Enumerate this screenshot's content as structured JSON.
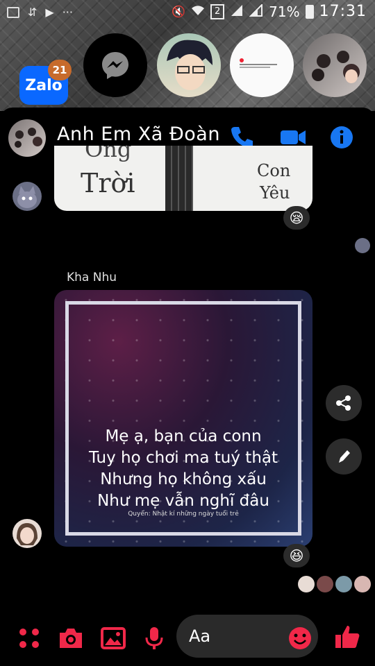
{
  "status_bar": {
    "sim_slot": "2",
    "battery": "71%",
    "time": "17:31"
  },
  "chat_heads": {
    "zalo_label": "Zalo",
    "zalo_badge": "21"
  },
  "header": {
    "title": "Anh Em Xã Đoàn"
  },
  "messages": {
    "top_image": {
      "left_text": "Trời",
      "right_text_1": "Con",
      "right_text_2": "Yêu",
      "top_left_fragment": "Ông"
    },
    "sender_name": "Kha Nhu",
    "image_text": [
      "Mẹ ạ, bạn của conn",
      "Tuy họ chơi ma tuý thật",
      "Nhưng họ không xấu",
      "Như mẹ vẫn nghĩ đâu"
    ],
    "image_credit": "Quyển: Nhật kí những ngày tuổi trẻ",
    "reaction_1": "😪",
    "reaction_2": "😆"
  },
  "composer": {
    "placeholder": "Aa"
  },
  "colors": {
    "accent": "#1877f2",
    "composer_icons": "#f02849",
    "background": "#000000"
  }
}
